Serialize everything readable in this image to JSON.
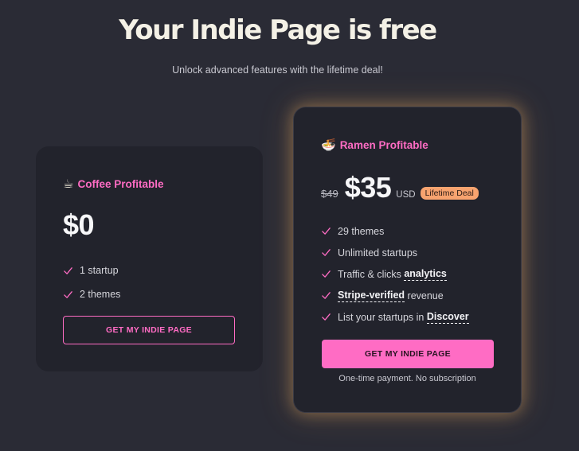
{
  "header": {
    "title": "Your Indie Page is free",
    "subtitle": "Unlock advanced features with the lifetime deal!"
  },
  "plans": {
    "free": {
      "emoji": "☕",
      "name": "Coffee Profitable",
      "price": "$0",
      "features": [
        "1 startup",
        "2 themes"
      ],
      "cta": "GET MY INDIE PAGE"
    },
    "deal": {
      "emoji": "🍜",
      "name": "Ramen Profitable",
      "old_price": "$49",
      "price": "$35",
      "currency": "USD",
      "badge": "Lifetime Deal",
      "features": {
        "f1": "29 themes",
        "f2": "Unlimited startups",
        "f3_prefix": "Traffic & clicks ",
        "f3_link": "analytics",
        "f4_link": "Stripe-verified",
        "f4_suffix": " revenue",
        "f5_prefix": "List your startups in ",
        "f5_link": "Discover"
      },
      "cta": "GET MY INDIE PAGE",
      "note": "One-time payment. No subscription"
    }
  },
  "colors": {
    "background": "#2a2b35",
    "card": "#22232c",
    "accent": "#ff6cc4",
    "badge": "#f7a36f",
    "glow": "#f5b464"
  },
  "icons": {
    "check": "check-icon"
  }
}
